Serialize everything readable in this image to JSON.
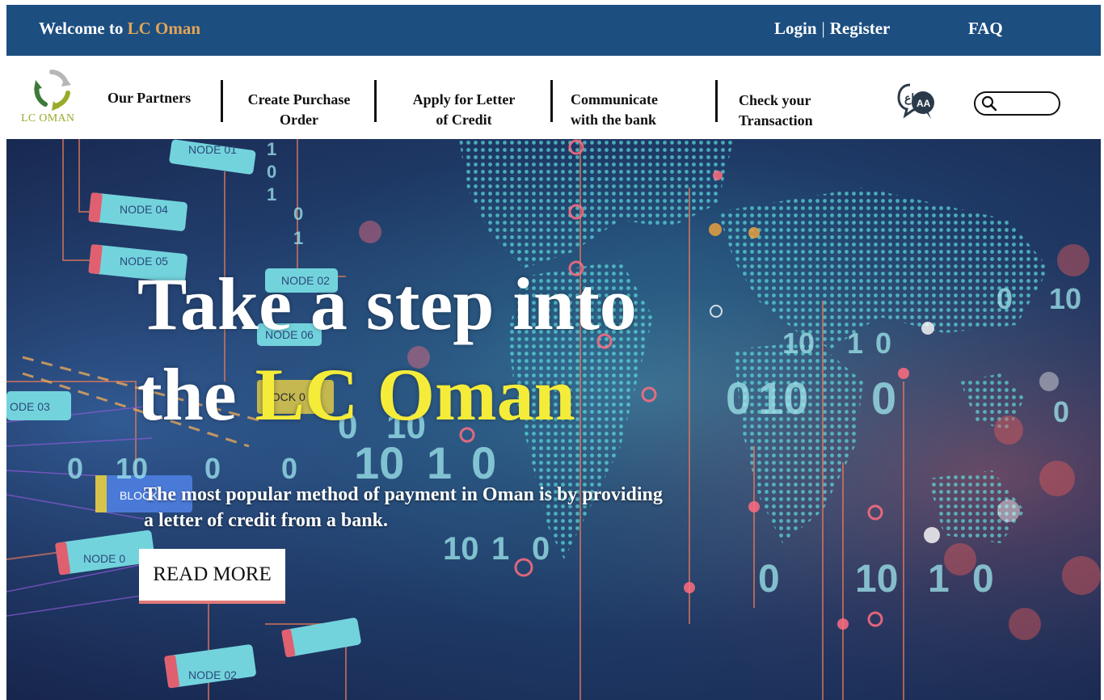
{
  "header": {
    "welcome_prefix": "Welcome to",
    "brand": "LC Oman",
    "login": "Login",
    "separator": "|",
    "register": "Register",
    "faq": "FAQ"
  },
  "logo": {
    "text": "LC OMAN"
  },
  "nav": {
    "items": [
      {
        "line1": "Our Partners",
        "line2": ""
      },
      {
        "line1": "Create Purchase",
        "line2": "Order"
      },
      {
        "line1": "Apply for Letter",
        "line2": "of Credit"
      },
      {
        "line1": "Communicate",
        "line2": "with the bank"
      },
      {
        "line1": "Check your",
        "line2": "Transaction"
      }
    ]
  },
  "search": {
    "placeholder": "",
    "value": ""
  },
  "icons": {
    "language": "translate-chat-icon",
    "search": "search-icon",
    "logo": "recycle-arrows-logo"
  },
  "hero": {
    "title_line1": "Take a step into",
    "title_line2_prefix": "the",
    "title_line2_accent": "LC Oman",
    "subtitle_line1": "The most popular method of payment in Oman is by providing",
    "subtitle_line2": "a letter of credit from a bank.",
    "cta": "READ MORE",
    "bg_labels": {
      "node01": "NODE 01",
      "node02": "NODE 02",
      "node03": "ODE 03",
      "node04": "NODE 04",
      "node05": "NODE 05",
      "node06": "NODE 06",
      "nodeX": "NODE 0",
      "block": "BLOCK",
      "block2": "LOCK 0"
    }
  },
  "colors": {
    "topbar": "#1c4e80",
    "brand_orange": "#e3a557",
    "hero_accent": "#f5ec3a",
    "cta_underline": "#e07a78",
    "logo_green": "#9aaa2a"
  }
}
